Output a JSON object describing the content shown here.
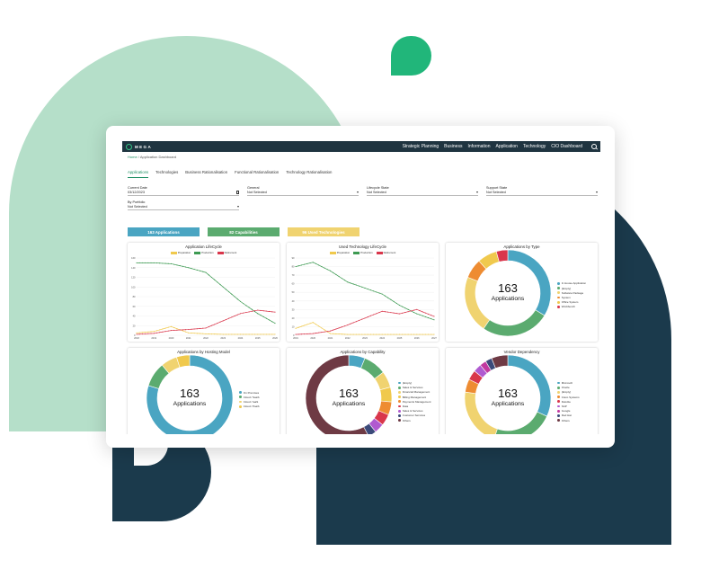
{
  "nav": {
    "logo_text": "MEGA",
    "items": [
      "Strategic Planning",
      "Business",
      "Information",
      "Application",
      "Technology",
      "CIO Dashboard"
    ]
  },
  "breadcrumb": {
    "home": "Home",
    "sep": "/",
    "current": "Application Dashboard"
  },
  "tabs": [
    "Applications",
    "Technologies",
    "Business Rationalisation",
    "Functional Rationalisation",
    "Technology Rationalisation"
  ],
  "filters": {
    "current_date": {
      "label": "Current Date",
      "value": "03/12/2023"
    },
    "general": {
      "label": "General",
      "value": "Not Selected"
    },
    "lifecycle_state": {
      "label": "Lifecycle State",
      "value": "Not Selected"
    },
    "support_state": {
      "label": "Support State",
      "value": "Not Selected"
    },
    "by_portfolio": {
      "label": "By Portfolio",
      "value": "Not Selected"
    }
  },
  "kpis": {
    "applications": "163 Applications",
    "capabilities": "82 Capabilities",
    "technologies": "96 Used Technologies"
  },
  "colors": {
    "nav_bg": "#1f3440",
    "accent_green": "#1e8f63",
    "blue": "#4aa5c2",
    "green": "#5bab6f",
    "yellow": "#f0d370",
    "red": "#d9364b",
    "orange": "#ee8c32",
    "maroon": "#6e3a44"
  },
  "chart_data": [
    {
      "type": "line",
      "title": "Application LifeCycle",
      "x": [
        "2018",
        "2019",
        "2020",
        "2021",
        "2022",
        "2023",
        "2024",
        "2025",
        "2026"
      ],
      "ylim": [
        0,
        160
      ],
      "yticks": [
        0,
        20,
        40,
        60,
        80,
        100,
        120,
        140,
        160
      ],
      "series": [
        {
          "name": "Preparation",
          "color": "#f0c94d",
          "values": [
            5,
            8,
            18,
            5,
            3,
            2,
            2,
            2,
            2
          ]
        },
        {
          "name": "Production",
          "color": "#3d9a52",
          "values": [
            150,
            150,
            148,
            140,
            130,
            100,
            70,
            45,
            25
          ]
        },
        {
          "name": "Retirement",
          "color": "#d9364b",
          "values": [
            2,
            4,
            10,
            12,
            15,
            30,
            45,
            52,
            48
          ]
        }
      ]
    },
    {
      "type": "line",
      "title": "Used Technology LifeCycle",
      "x": [
        "2019",
        "2020",
        "2021",
        "2022",
        "2023",
        "2024",
        "2025",
        "2026",
        "2027"
      ],
      "ylim": [
        0,
        90
      ],
      "yticks": [
        0,
        10,
        20,
        30,
        40,
        50,
        60,
        70,
        80,
        90
      ],
      "series": [
        {
          "name": "Preparation",
          "color": "#f0c94d",
          "values": [
            8,
            15,
            2,
            1,
            1,
            1,
            1,
            1,
            1
          ]
        },
        {
          "name": "Production",
          "color": "#3d9a52",
          "values": [
            80,
            85,
            75,
            62,
            55,
            48,
            35,
            25,
            18
          ]
        },
        {
          "name": "Retirement",
          "color": "#d9364b",
          "values": [
            1,
            2,
            5,
            12,
            20,
            28,
            25,
            30,
            22
          ]
        }
      ]
    },
    {
      "type": "pie",
      "title": "Applications by Type",
      "center_value": "163",
      "center_label": "Applications",
      "slices": [
        {
          "name": "In House Application",
          "value": 55,
          "color": "#4aa5c2"
        },
        {
          "name": "(Empty)",
          "value": 42,
          "color": "#5bab6f"
        },
        {
          "name": "Software Package",
          "value": 35,
          "color": "#f0d370"
        },
        {
          "name": "System",
          "value": 12,
          "color": "#ee8c32"
        },
        {
          "name": "Office System",
          "value": 12,
          "color": "#f0c94d"
        },
        {
          "name": "Workbench",
          "value": 7,
          "color": "#d9364b"
        }
      ]
    },
    {
      "type": "pie",
      "title": "Applications by Hosting Model",
      "center_value": "163",
      "center_label": "Applications",
      "slices": [
        {
          "name": "On Premises",
          "value": 130,
          "color": "#4aa5c2"
        },
        {
          "name": "Cloud / SaaS",
          "value": 15,
          "color": "#5bab6f"
        },
        {
          "name": "Cloud / IaaS",
          "value": 10,
          "color": "#f0d370"
        },
        {
          "name": "Cloud / PaaS",
          "value": 8,
          "color": "#f0c94d"
        }
      ]
    },
    {
      "type": "pie",
      "title": "Applications by Capability",
      "center_value": "163",
      "center_label": "Applications",
      "slices": [
        {
          "name": "(Empty)",
          "value": 10,
          "color": "#4aa5c2"
        },
        {
          "name": "Sales & Services",
          "value": 14,
          "color": "#5bab6f"
        },
        {
          "name": "Financial Management",
          "value": 10,
          "color": "#f0d370"
        },
        {
          "name": "Billing Management",
          "value": 9,
          "color": "#f0c94d"
        },
        {
          "name": "Payments Management",
          "value": 8,
          "color": "#ee8c32"
        },
        {
          "name": "Data",
          "value": 7,
          "color": "#d9364b"
        },
        {
          "name": "Sales & Services",
          "value": 6,
          "color": "#b05ad0"
        },
        {
          "name": "Customer Services",
          "value": 5,
          "color": "#3b4a7a"
        },
        {
          "name": "Others",
          "value": 94,
          "color": "#6e3a44"
        }
      ]
    },
    {
      "type": "pie",
      "title": "Vendor Dependency",
      "center_value": "163",
      "center_label": "Applications",
      "slices": [
        {
          "name": "Microsoft",
          "value": 52,
          "color": "#4aa5c2"
        },
        {
          "name": "Oracle",
          "value": 38,
          "color": "#5bab6f"
        },
        {
          "name": "(Empty)",
          "value": 36,
          "color": "#f0d370"
        },
        {
          "name": "Cisco Systems",
          "value": 8,
          "color": "#ee8c32"
        },
        {
          "name": "Deloitte",
          "value": 6,
          "color": "#d9364b"
        },
        {
          "name": "SAP",
          "value": 5,
          "color": "#b05ad0"
        },
        {
          "name": "Google",
          "value": 4,
          "color": "#c23aa0"
        },
        {
          "name": "Red Hat",
          "value": 4,
          "color": "#3b4a7a"
        },
        {
          "name": "Others",
          "value": 10,
          "color": "#6e3a44"
        }
      ]
    }
  ]
}
